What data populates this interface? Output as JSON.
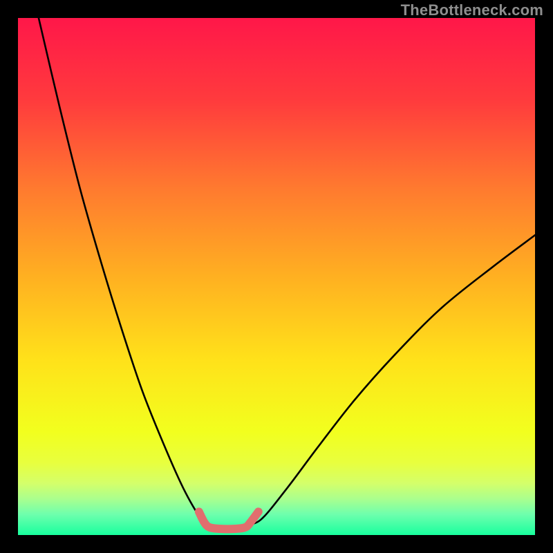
{
  "watermark": "TheBottleneck.com",
  "chart_data": {
    "type": "line",
    "title": "",
    "xlabel": "",
    "ylabel": "",
    "xlim": [
      0,
      100
    ],
    "ylim": [
      0,
      100
    ],
    "series": [
      {
        "name": "left-curve",
        "x": [
          4,
          8,
          12,
          16,
          20,
          24,
          28,
          32,
          35.5,
          37
        ],
        "y": [
          100,
          83,
          67,
          53,
          40,
          28,
          18,
          9,
          3,
          2
        ]
      },
      {
        "name": "right-curve",
        "x": [
          44,
          47,
          52,
          58,
          65,
          73,
          82,
          92,
          100
        ],
        "y": [
          2,
          3,
          9,
          17,
          26,
          35,
          44,
          52,
          58
        ]
      },
      {
        "name": "valley-highlight",
        "x": [
          35,
          36,
          37,
          39,
          42,
          44,
          45,
          46.5
        ],
        "y": [
          4.5,
          2.5,
          1.5,
          1.2,
          1.2,
          1.5,
          2.5,
          4.5
        ]
      }
    ],
    "gradient_stops": [
      {
        "offset": 0.0,
        "color": "#ff1749"
      },
      {
        "offset": 0.16,
        "color": "#ff3b3d"
      },
      {
        "offset": 0.33,
        "color": "#ff7a2f"
      },
      {
        "offset": 0.5,
        "color": "#ffb021"
      },
      {
        "offset": 0.66,
        "color": "#ffe11a"
      },
      {
        "offset": 0.8,
        "color": "#f2ff1e"
      },
      {
        "offset": 0.86,
        "color": "#e8ff3e"
      },
      {
        "offset": 0.9,
        "color": "#d4ff6a"
      },
      {
        "offset": 0.93,
        "color": "#aaff8e"
      },
      {
        "offset": 0.96,
        "color": "#6effad"
      },
      {
        "offset": 1.0,
        "color": "#18ff9e"
      }
    ],
    "highlight_color": "#e16e6e",
    "curve_color": "#000000"
  }
}
